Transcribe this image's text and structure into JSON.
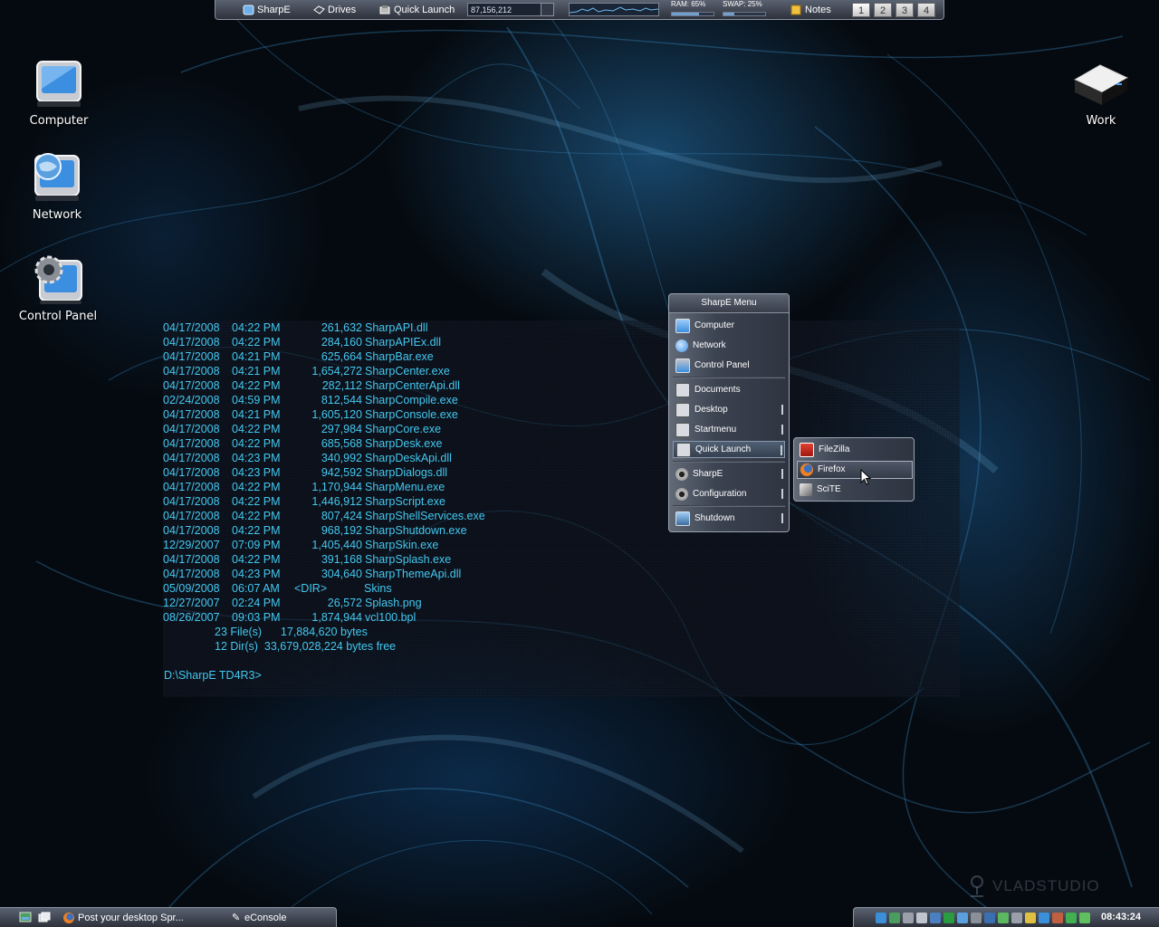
{
  "topbar": {
    "items": [
      {
        "label": "SharpE",
        "icon": "sharpe-icon"
      },
      {
        "label": "Drives",
        "icon": "drive-icon"
      },
      {
        "label": "Quick Launch",
        "icon": "quicklaunch-icon"
      }
    ],
    "memory_value": "87,156,212",
    "ram_label": "RAM: 65%",
    "ram_percent": 65,
    "swap_label": "SWAP: 25%",
    "swap_percent": 25,
    "notes_label": "Notes",
    "workspaces": [
      "1",
      "2",
      "3",
      "4"
    ],
    "active_workspace": "1"
  },
  "desktop_icons": [
    {
      "label": "Computer",
      "icon": "computer-icon"
    },
    {
      "label": "Network",
      "icon": "network-icon"
    },
    {
      "label": "Control Panel",
      "icon": "control-panel-icon"
    },
    {
      "label": "Work",
      "icon": "drive-icon"
    }
  ],
  "console": {
    "rows": [
      {
        "date": "04/17/2008",
        "time": "04:22 PM",
        "size": "261,632",
        "name": "SharpAPI.dll"
      },
      {
        "date": "04/17/2008",
        "time": "04:22 PM",
        "size": "284,160",
        "name": "SharpAPIEx.dll"
      },
      {
        "date": "04/17/2008",
        "time": "04:21 PM",
        "size": "625,664",
        "name": "SharpBar.exe"
      },
      {
        "date": "04/17/2008",
        "time": "04:21 PM",
        "size": "1,654,272",
        "name": "SharpCenter.exe"
      },
      {
        "date": "04/17/2008",
        "time": "04:22 PM",
        "size": "282,112",
        "name": "SharpCenterApi.dll"
      },
      {
        "date": "02/24/2008",
        "time": "04:59 PM",
        "size": "812,544",
        "name": "SharpCompile.exe"
      },
      {
        "date": "04/17/2008",
        "time": "04:21 PM",
        "size": "1,605,120",
        "name": "SharpConsole.exe"
      },
      {
        "date": "04/17/2008",
        "time": "04:22 PM",
        "size": "297,984",
        "name": "SharpCore.exe"
      },
      {
        "date": "04/17/2008",
        "time": "04:22 PM",
        "size": "685,568",
        "name": "SharpDesk.exe"
      },
      {
        "date": "04/17/2008",
        "time": "04:23 PM",
        "size": "340,992",
        "name": "SharpDeskApi.dll"
      },
      {
        "date": "04/17/2008",
        "time": "04:23 PM",
        "size": "942,592",
        "name": "SharpDialogs.dll"
      },
      {
        "date": "04/17/2008",
        "time": "04:22 PM",
        "size": "1,170,944",
        "name": "SharpMenu.exe"
      },
      {
        "date": "04/17/2008",
        "time": "04:22 PM",
        "size": "1,446,912",
        "name": "SharpScript.exe"
      },
      {
        "date": "04/17/2008",
        "time": "04:22 PM",
        "size": "807,424",
        "name": "SharpShellServices.exe"
      },
      {
        "date": "04/17/2008",
        "time": "04:22 PM",
        "size": "968,192",
        "name": "SharpShutdown.exe"
      },
      {
        "date": "12/29/2007",
        "time": "07:09 PM",
        "size": "1,405,440",
        "name": "SharpSkin.exe"
      },
      {
        "date": "04/17/2008",
        "time": "04:22 PM",
        "size": "391,168",
        "name": "SharpSplash.exe"
      },
      {
        "date": "04/17/2008",
        "time": "04:23 PM",
        "size": "304,640",
        "name": "SharpThemeApi.dll"
      },
      {
        "date": "05/09/2008",
        "time": "06:07 AM",
        "size": "<DIR>",
        "name": "Skins"
      },
      {
        "date": "12/27/2007",
        "time": "02:24 PM",
        "size": "26,572",
        "name": "Splash.png"
      },
      {
        "date": "08/26/2007",
        "time": "09:03 PM",
        "size": "1,874,944",
        "name": "vcl100.bpl"
      }
    ],
    "files_summary": "23 File(s)      17,884,620 bytes",
    "dirs_summary": "12 Dir(s)  33,679,028,224 bytes free",
    "prompt": "D:\\SharpE TD4R3>"
  },
  "menu": {
    "title": "SharpE Menu",
    "items": [
      {
        "label": "Computer",
        "icon": "computer-icon",
        "arrow": false
      },
      {
        "label": "Network",
        "icon": "network-icon",
        "arrow": false
      },
      {
        "label": "Control Panel",
        "icon": "control-panel-icon",
        "arrow": false
      },
      {
        "label": "Documents",
        "icon": "folder-icon",
        "arrow": false
      },
      {
        "label": "Desktop",
        "icon": "folder-icon",
        "arrow": true
      },
      {
        "label": "Startmenu",
        "icon": "folder-icon",
        "arrow": true
      },
      {
        "label": "Quick Launch",
        "icon": "folder-icon",
        "arrow": true
      },
      {
        "label": "SharpE",
        "icon": "gear-icon",
        "arrow": true
      },
      {
        "label": "Configuration",
        "icon": "gear-icon",
        "arrow": true
      },
      {
        "label": "Shutdown",
        "icon": "shutdown-icon",
        "arrow": true
      }
    ],
    "selected": "Quick Launch"
  },
  "submenu": {
    "items": [
      {
        "label": "FileZilla",
        "icon": "filezilla-icon"
      },
      {
        "label": "Firefox",
        "icon": "firefox-icon"
      },
      {
        "label": "SciTE",
        "icon": "scite-icon"
      }
    ],
    "selected": "Firefox"
  },
  "watermark": "VLADSTUDIO",
  "taskbar": {
    "tasks": [
      {
        "label": "Post your desktop Spr...",
        "icon": "firefox-icon"
      },
      {
        "label": "eConsole",
        "icon": "console-icon"
      }
    ],
    "clock": "08:43:24"
  },
  "colors": {
    "console_text": "#44c8f0",
    "panel_dark": "#2c313b",
    "panel_light": "#5a6170"
  }
}
